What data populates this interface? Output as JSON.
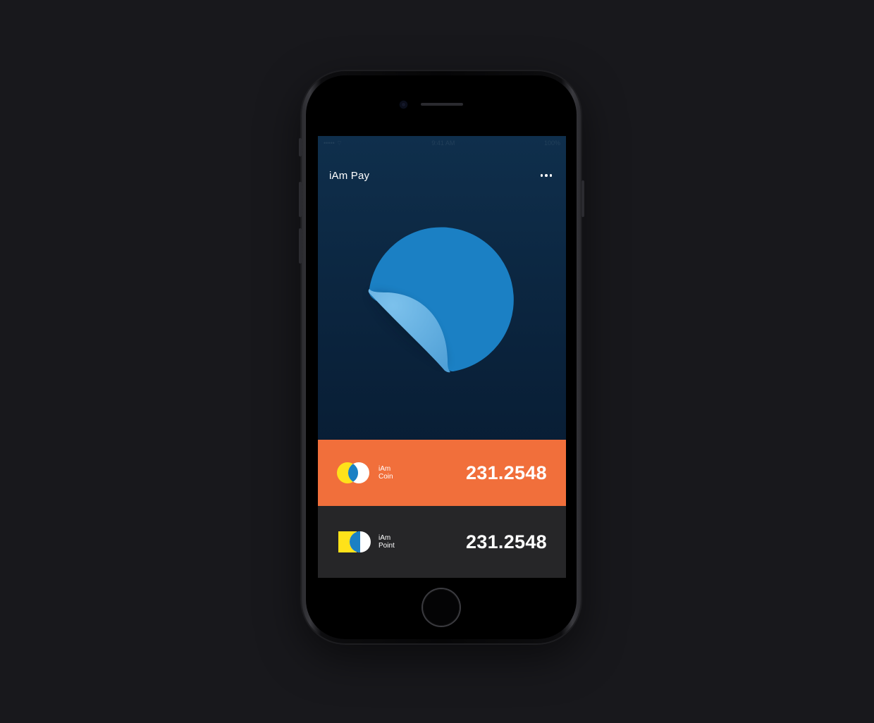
{
  "app": {
    "title": "iAm Pay"
  },
  "status_bar": {
    "carrier": "••••• ⌔",
    "time": "9:41 AM",
    "battery": "100%"
  },
  "cards": [
    {
      "label_line1": "iAm",
      "label_line2": "Coin",
      "amount": "231.2548",
      "color": "#f16f3b"
    },
    {
      "label_line1": "iAm",
      "label_line2": "Point",
      "amount": "231.2548",
      "color": "#262628"
    }
  ],
  "colors": {
    "background": "#18181c",
    "screen_top": "#0f2f4c",
    "screen_bottom": "#06182c",
    "sticker_main": "#1b80c4",
    "sticker_curl": "#65b3e5",
    "logo_yellow": "#ffe21a",
    "logo_blue": "#1b80c4"
  },
  "icons": {
    "menu": "more-horizontal-icon",
    "sticker": "peeling-sticker-icon",
    "coin_logo": "coin-logo-icon",
    "point_logo": "point-logo-icon"
  }
}
